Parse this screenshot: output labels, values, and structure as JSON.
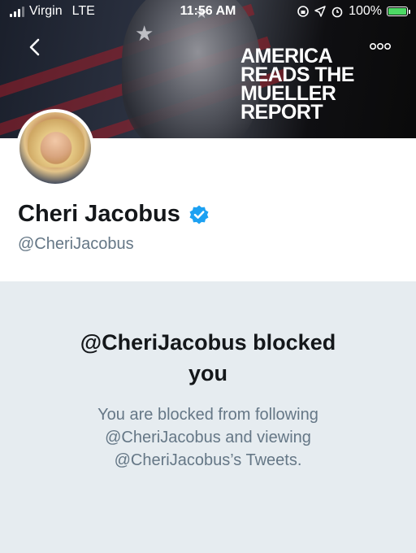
{
  "status_bar": {
    "carrier": "Virgin",
    "network": "LTE",
    "time": "11:56 AM",
    "battery": "100%",
    "battery_color": "#4cd964"
  },
  "header": {
    "back_icon": "chevron-left-icon",
    "more_icon": "more-dots-icon",
    "banner_lines": [
      "AMERICA",
      "READS THE",
      "MUELLER",
      "REPORT"
    ]
  },
  "profile": {
    "name": "Cheri Jacobus",
    "handle": "@CheriJacobus",
    "verified_color": "#1da1f2"
  },
  "blocked": {
    "title_line1": "@CheriJacobus blocked",
    "title_line2": "you",
    "desc_line1": "You are blocked from following",
    "desc_line2": "@CheriJacobus and viewing",
    "desc_line3": "@CheriJacobus’s Tweets."
  }
}
